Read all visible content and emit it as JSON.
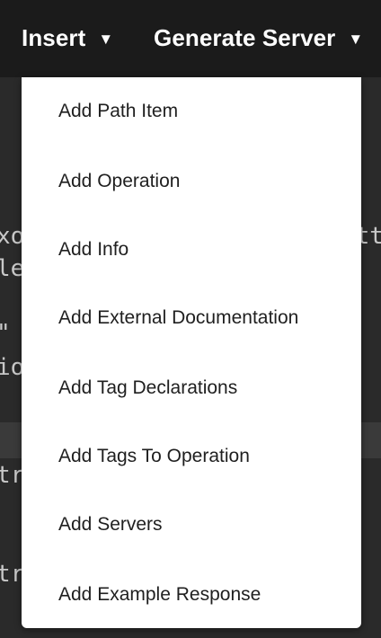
{
  "menubar": {
    "insert_label": "Insert",
    "generate_server_label": "Generate Server",
    "caret": "▼"
  },
  "insert_menu": {
    "items": [
      {
        "label": "Add Path Item"
      },
      {
        "label": "Add Operation"
      },
      {
        "label": "Add Info"
      },
      {
        "label": "Add External Documentation"
      },
      {
        "label": "Add Tag Declarations"
      },
      {
        "label": "Add Tags To Operation"
      },
      {
        "label": "Add Servers"
      },
      {
        "label": "Add Example Response"
      }
    ]
  },
  "editor": {
    "fragments": [
      "xo",
      "le",
      "\"",
      "io",
      "tr",
      "tr",
      "att"
    ]
  },
  "colors": {
    "topbar": "#1b1b1b",
    "editor_bg": "#2a2a2a",
    "menu_bg": "#ffffff",
    "menu_text": "#1f1f1f"
  }
}
